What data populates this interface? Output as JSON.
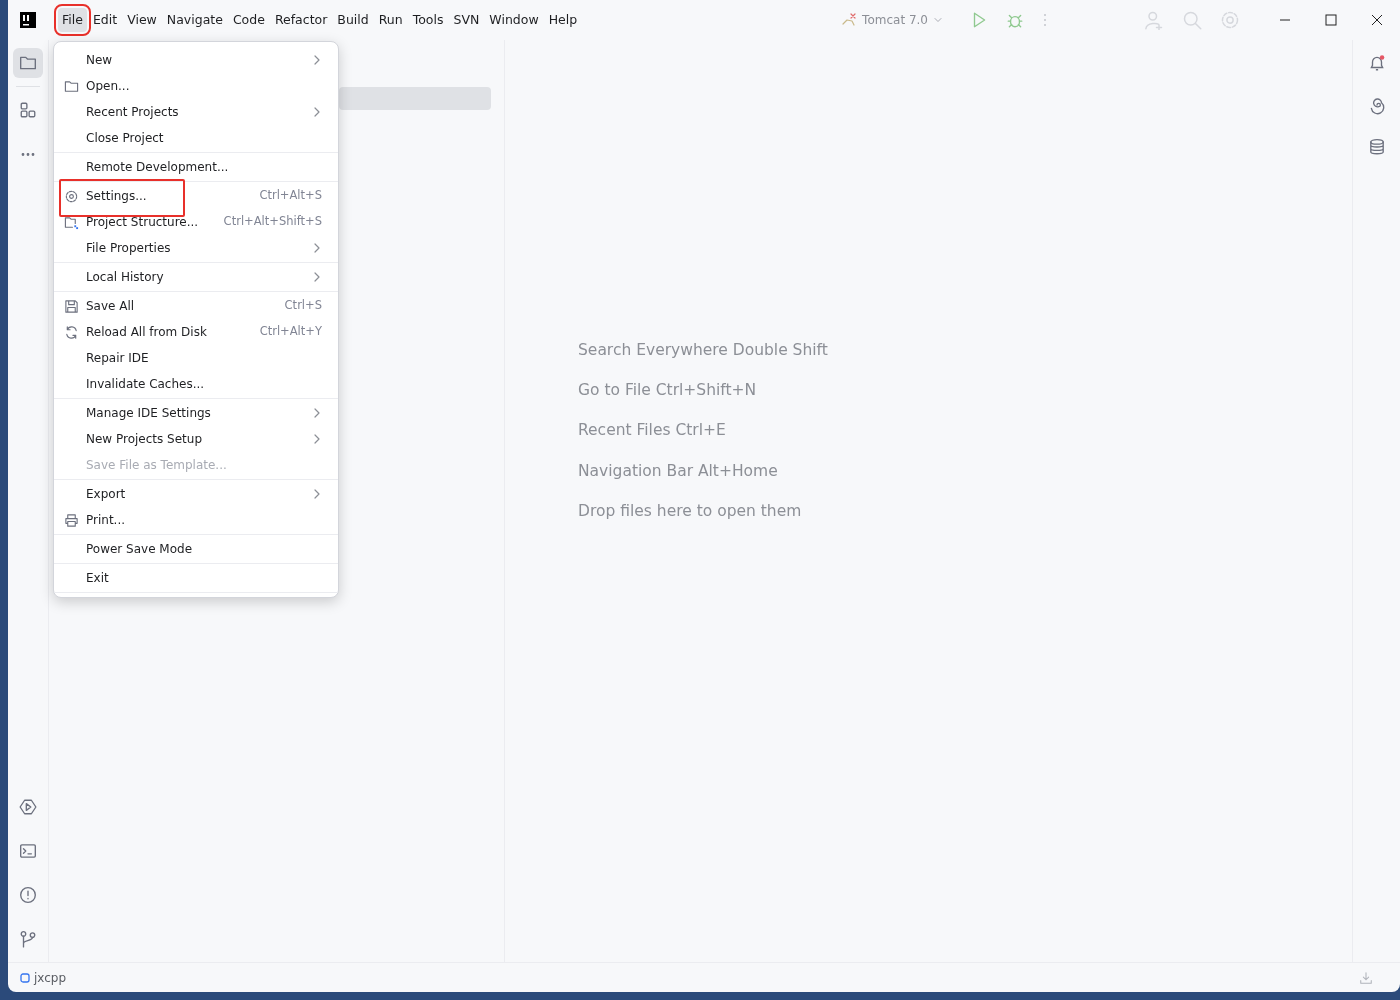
{
  "menu_bar": [
    {
      "label": "File",
      "selected": true,
      "highlighted": true
    },
    {
      "label": "Edit",
      "selected": false,
      "highlighted": false
    },
    {
      "label": "View",
      "selected": false,
      "highlighted": false
    },
    {
      "label": "Navigate",
      "selected": false,
      "highlighted": false
    },
    {
      "label": "Code",
      "selected": false,
      "highlighted": false
    },
    {
      "label": "Refactor",
      "selected": false,
      "highlighted": false
    },
    {
      "label": "Build",
      "selected": false,
      "highlighted": false
    },
    {
      "label": "Run",
      "selected": false,
      "highlighted": false
    },
    {
      "label": "Tools",
      "selected": false,
      "highlighted": false
    },
    {
      "label": "SVN",
      "selected": false,
      "highlighted": false
    },
    {
      "label": "Window",
      "selected": false,
      "highlighted": false
    },
    {
      "label": "Help",
      "selected": false,
      "highlighted": false
    }
  ],
  "run_configuration": {
    "label": "Tomcat 7.0"
  },
  "file_menu": {
    "groups": [
      [
        {
          "label": "New",
          "submenu": true,
          "disabled": false,
          "highlighted": false
        },
        {
          "label": "Open...",
          "submenu": false,
          "disabled": false,
          "highlighted": false
        },
        {
          "label": "Recent Projects",
          "submenu": true,
          "disabled": false,
          "highlighted": false
        },
        {
          "label": "Close Project",
          "submenu": false,
          "disabled": false,
          "highlighted": false
        }
      ],
      [
        {
          "label": "Remote Development...",
          "submenu": false,
          "disabled": false,
          "highlighted": false
        }
      ],
      [
        {
          "label": "Settings...",
          "shortcut": "Ctrl+Alt+S",
          "submenu": false,
          "disabled": false,
          "highlighted": true
        },
        {
          "label": "Project Structure...",
          "shortcut": "Ctrl+Alt+Shift+S",
          "submenu": false,
          "disabled": false,
          "highlighted": false
        },
        {
          "label": "File Properties",
          "submenu": true,
          "disabled": false,
          "highlighted": false
        }
      ],
      [
        {
          "label": "Local History",
          "submenu": true,
          "disabled": false,
          "highlighted": false
        }
      ],
      [
        {
          "label": "Save All",
          "shortcut": "Ctrl+S",
          "submenu": false,
          "disabled": false,
          "highlighted": false
        },
        {
          "label": "Reload All from Disk",
          "shortcut": "Ctrl+Alt+Y",
          "submenu": false,
          "disabled": false,
          "highlighted": false
        },
        {
          "label": "Repair IDE",
          "submenu": false,
          "disabled": false,
          "highlighted": false
        },
        {
          "label": "Invalidate Caches...",
          "submenu": false,
          "disabled": false,
          "highlighted": false
        }
      ],
      [
        {
          "label": "Manage IDE Settings",
          "submenu": true,
          "disabled": false,
          "highlighted": false
        },
        {
          "label": "New Projects Setup",
          "submenu": true,
          "disabled": false,
          "highlighted": false
        },
        {
          "label": "Save File as Template...",
          "submenu": false,
          "disabled": true,
          "highlighted": false
        }
      ],
      [
        {
          "label": "Export",
          "submenu": true,
          "disabled": false,
          "highlighted": false
        },
        {
          "label": "Print...",
          "submenu": false,
          "disabled": false,
          "highlighted": false
        }
      ],
      [
        {
          "label": "Power Save Mode",
          "submenu": false,
          "disabled": false,
          "highlighted": false
        }
      ],
      [
        {
          "label": "Exit",
          "submenu": false,
          "disabled": false,
          "highlighted": false
        }
      ]
    ]
  },
  "editor_hints": [
    "Search Everywhere Double Shift",
    "Go to File Ctrl+Shift+N",
    "Recent Files Ctrl+E",
    "Navigation Bar Alt+Home",
    "Drop files here to open them"
  ],
  "status_bar": {
    "project": "jxcpp"
  }
}
